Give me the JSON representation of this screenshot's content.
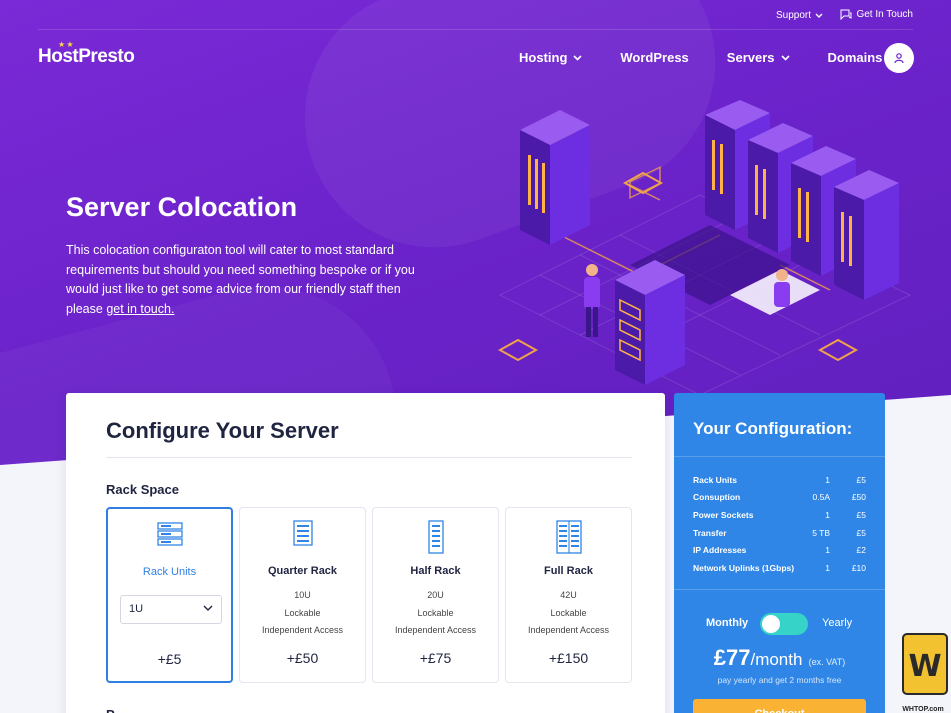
{
  "topbar": {
    "support_label": "Support",
    "contact_label": "Get In Touch"
  },
  "brand": {
    "name": "HostPresto"
  },
  "nav": {
    "items": [
      {
        "label": "Hosting",
        "has_dropdown": true
      },
      {
        "label": "WordPress",
        "has_dropdown": false
      },
      {
        "label": "Servers",
        "has_dropdown": true
      },
      {
        "label": "Domains",
        "has_dropdown": false
      }
    ]
  },
  "hero": {
    "title": "Server Colocation",
    "text": "This colocation configuraton tool will cater to most standard requirements but should you need something bespoke or if you would just like to get some advice from our friendly staff then please ",
    "link": "get in touch."
  },
  "configure": {
    "title": "Configure Your Server",
    "rack_section": "Rack Space",
    "next_section": "P",
    "racks": [
      {
        "name": "Rack Units",
        "selected": true,
        "select_value": "1U",
        "price": "+£5"
      },
      {
        "name": "Quarter Rack",
        "size": "10U",
        "lock": "Lockable",
        "access": "Independent Access",
        "price": "+£50"
      },
      {
        "name": "Half Rack",
        "size": "20U",
        "lock": "Lockable",
        "access": "Independent Access",
        "price": "+£75"
      },
      {
        "name": "Full Rack",
        "size": "42U",
        "lock": "Lockable",
        "access": "Independent Access",
        "price": "+£150"
      }
    ]
  },
  "summary": {
    "title": "Your Configuration:",
    "rows": [
      {
        "label": "Rack Units",
        "qty": "1",
        "price": "£5"
      },
      {
        "label": "Consuption",
        "qty": "0.5A",
        "price": "£50"
      },
      {
        "label": "Power Sockets",
        "qty": "1",
        "price": "£5"
      },
      {
        "label": "Transfer",
        "qty": "5 TB",
        "price": "£5"
      },
      {
        "label": "IP Addresses",
        "qty": "1",
        "price": "£2"
      },
      {
        "label": "Network Uplinks (1Gbps)",
        "qty": "1",
        "price": "£10"
      }
    ],
    "monthly_label": "Monthly",
    "yearly_label": "Yearly",
    "price_amount": "£77",
    "price_period": "/month",
    "price_vat": "(ex. VAT)",
    "note": "pay yearly and get 2 months free",
    "checkout_label": "Checkout"
  },
  "watermark": {
    "text": "WHTOP.com"
  },
  "colors": {
    "hero_purple": "#6a22c9",
    "accent_blue": "#2f86e6",
    "toggle_teal": "#35d3c8",
    "checkout_orange": "#f9b233"
  }
}
